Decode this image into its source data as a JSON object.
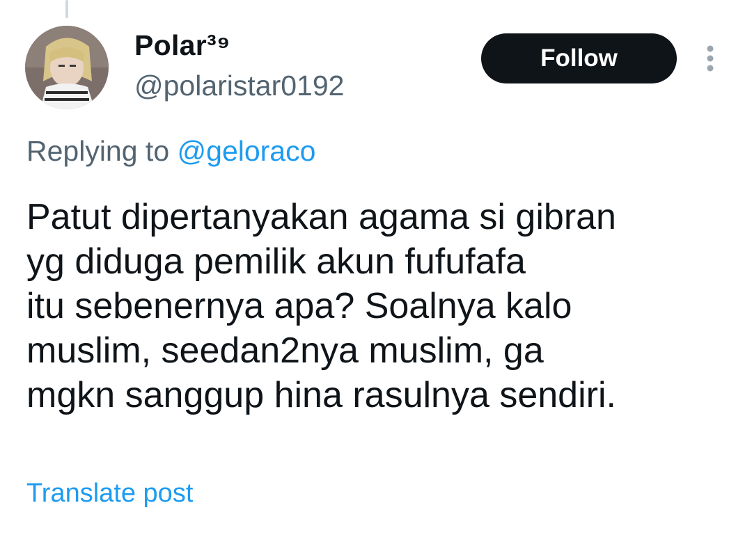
{
  "author": {
    "display_name": "Polar³⁹",
    "handle": "@polaristar0192"
  },
  "header": {
    "follow_label": "Follow",
    "more_icon": "more-vertical-icon"
  },
  "reply": {
    "prefix": "Replying to ",
    "mention": "@geloraco"
  },
  "post": {
    "lines": [
      "Patut dipertanyakan agama si gibran",
      "yg diduga pemilik akun fufufafa",
      "itu sebenernya apa? Soalnya kalo",
      "muslim, seedan2nya muslim, ga",
      "mgkn sanggup hina rasulnya sendiri."
    ]
  },
  "footer": {
    "translate_label": "Translate post"
  },
  "colors": {
    "text": "#0f1419",
    "secondary": "#536471",
    "link": "#1d9bf0",
    "button": "#0f1419"
  }
}
